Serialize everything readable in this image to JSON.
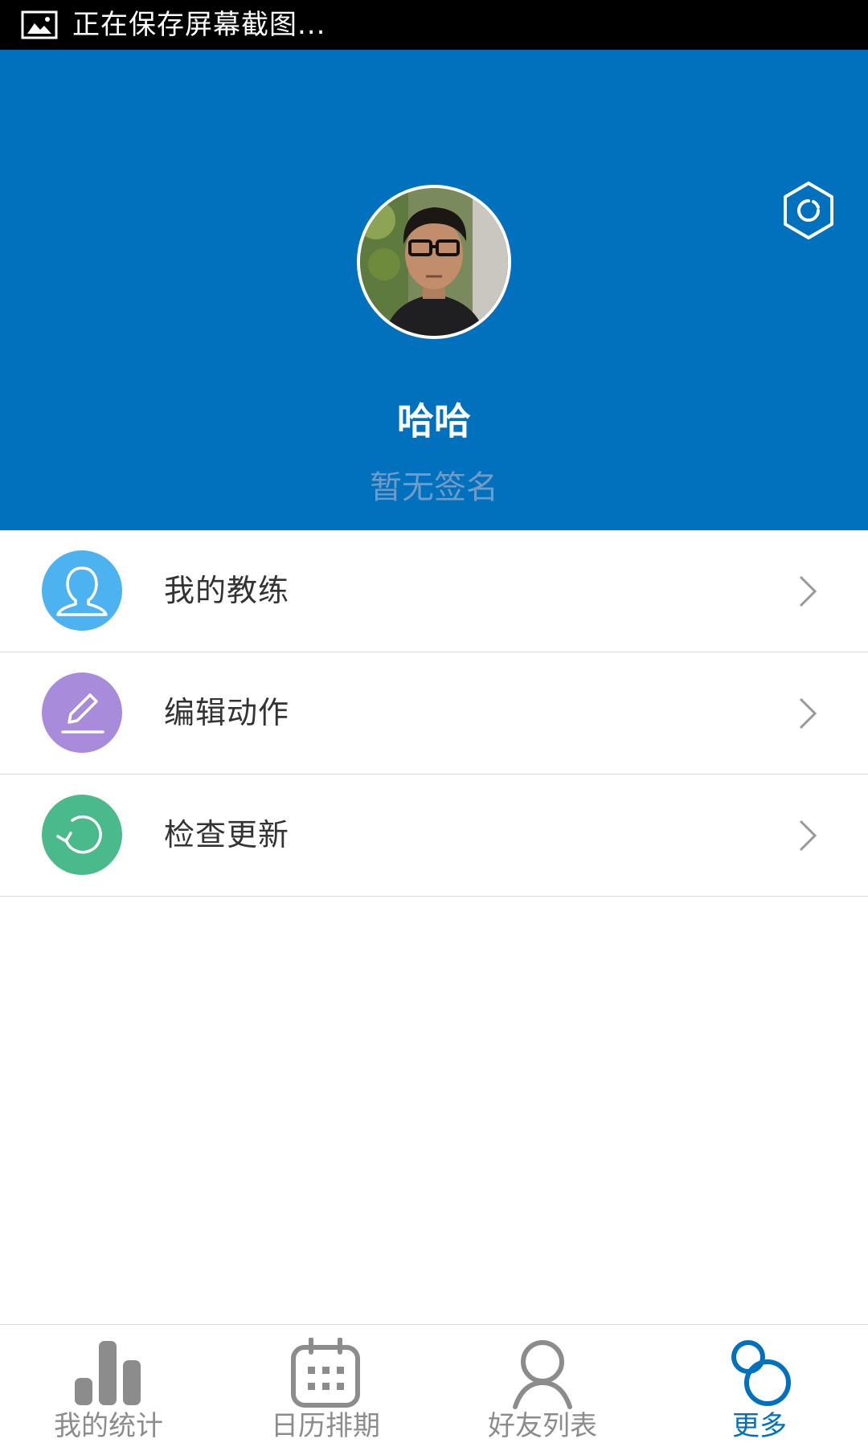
{
  "status_bar": {
    "notification_icon": "image-icon",
    "text": "正在保存屏幕截图..."
  },
  "header": {
    "background_color": "#0170bd",
    "settings_icon": "gear-icon",
    "user_name": "哈哈",
    "signature": "暂无签名"
  },
  "menu": {
    "items": [
      {
        "label": "我的教练",
        "icon": "user-icon",
        "icon_color": "#4db3f0"
      },
      {
        "label": "编辑动作",
        "icon": "pencil-icon",
        "icon_color": "#a98bdc"
      },
      {
        "label": "检查更新",
        "icon": "refresh-icon",
        "icon_color": "#4aba8c"
      }
    ],
    "chevron_icon": "chevron-right-icon"
  },
  "bottom_nav": {
    "active_color": "#0170bd",
    "inactive_color": "#8c8c8c",
    "items": [
      {
        "label": "我的统计",
        "icon": "bar-chart-icon",
        "active": false
      },
      {
        "label": "日历排期",
        "icon": "calendar-icon",
        "active": false
      },
      {
        "label": "好友列表",
        "icon": "person-icon",
        "active": false
      },
      {
        "label": "更多",
        "icon": "more-icon",
        "active": true
      }
    ]
  }
}
